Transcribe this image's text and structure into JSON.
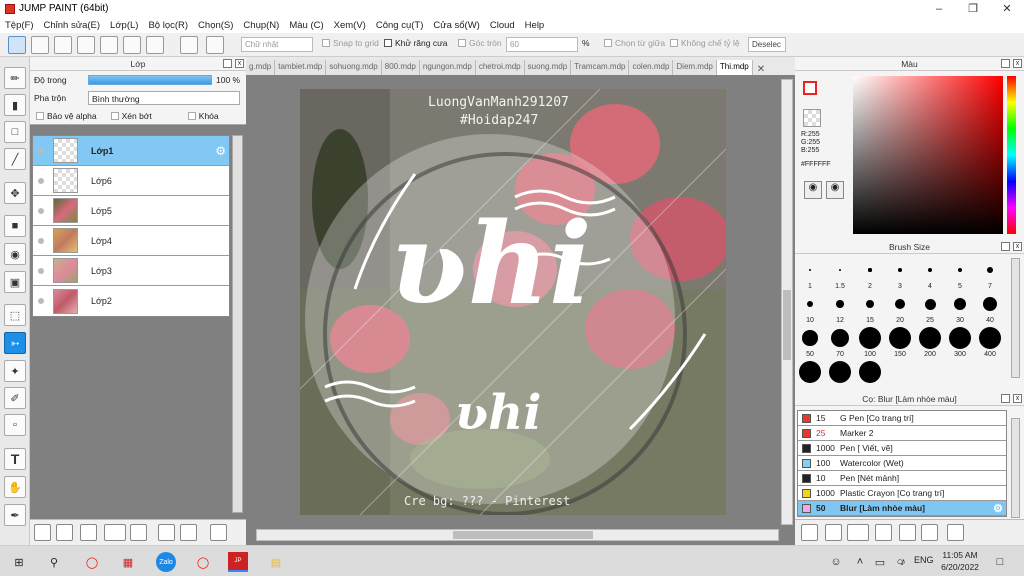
{
  "window": {
    "title": "JUMP PAINT (64bit)"
  },
  "menu": [
    "Tệp(F)",
    "Chỉnh sửa(E)",
    "Lớp(L)",
    "Bộ lọc(R)",
    "Chọn(S)",
    "Chụp(N)",
    "Màu (C)",
    "Xem(V)",
    "Công cụ(T)",
    "Cửa sổ(W)",
    "Cloud",
    "Help"
  ],
  "toolbar": {
    "shape": "Chữ nhật",
    "snap_grid": "Snap to grid",
    "antialias": "Khử răng cưa",
    "corner": "Góc tròn",
    "corner_value": "60",
    "percent": "%",
    "select_center": "Chọn từ giữa",
    "no_ratio": "Không chế tỷ lệ",
    "deselect": "Deselec"
  },
  "layer_panel": {
    "title": "Lớp",
    "opacity_label": "Độ trong",
    "opacity_value": "100 %",
    "blend_label": "Pha trộn",
    "blend_value": "Bình thường",
    "protect_alpha": "Bảo vệ alpha",
    "clip": "Xén bớt",
    "lock": "Khóa",
    "layers": [
      {
        "name": "Lớp1",
        "selected": true
      },
      {
        "name": "Lớp6"
      },
      {
        "name": "Lớp5"
      },
      {
        "name": "Lớp4"
      },
      {
        "name": "Lớp3"
      },
      {
        "name": "Lớp2"
      }
    ]
  },
  "tabs": [
    "g.mdp",
    "tambiet.mdp",
    "sohuong.mdp",
    "800.mdp",
    "ngungon.mdp",
    "chetroi.mdp",
    "suong.mdp",
    "Tramcam.mdp",
    "colen.mdp",
    "Diem.mdp",
    "Thi.mdp"
  ],
  "artwork": {
    "top_text_1": "LuongVanManh291207",
    "top_text_2": "#Hoidap247",
    "main_word": "ʋhi",
    "sub_word": "ʋhi",
    "credit": "Cre bg: ??? - Pinterest"
  },
  "color_panel": {
    "title": "Màu",
    "r": "R:255",
    "g": "G:255",
    "b": "B:255",
    "hex": "#FFFFFF"
  },
  "brush_panel": {
    "title": "Brush Size",
    "sizes": [
      "1",
      "1.5",
      "2",
      "3",
      "4",
      "5",
      "7",
      "10",
      "12",
      "15",
      "20",
      "25",
      "30",
      "40",
      "50",
      "70",
      "100",
      "150",
      "200",
      "300",
      "400",
      "",
      "",
      ""
    ]
  },
  "tool_panel": {
    "title": "Cọ: Blur [Làm nhòe màu]",
    "items": [
      {
        "size": "15",
        "name": "G Pen [Cọ trang trí]",
        "color": "#e8372f"
      },
      {
        "size": "25",
        "name": "Marker 2",
        "color": "#e8372f"
      },
      {
        "size": "1000",
        "name": "Pen [ Viết, vẽ]",
        "color": "#222222"
      },
      {
        "size": "100",
        "name": "Watercolor (Wet)",
        "color": "#7fd0f2"
      },
      {
        "size": "10",
        "name": "Pen [Nét mảnh]",
        "color": "#222222"
      },
      {
        "size": "1000",
        "name": "Plastic Crayon [Cọ trang trí]",
        "color": "#f2d21a"
      },
      {
        "size": "50",
        "name": "Blur [Làm nhòe màu]",
        "color": "#f0a8e8",
        "selected": true
      }
    ]
  },
  "taskbar": {
    "lang": "ENG",
    "time": "11:05 AM",
    "date": "6/20/2022"
  },
  "colors": {
    "accent": "#1e8fe6",
    "selection": "#82c8f5"
  }
}
